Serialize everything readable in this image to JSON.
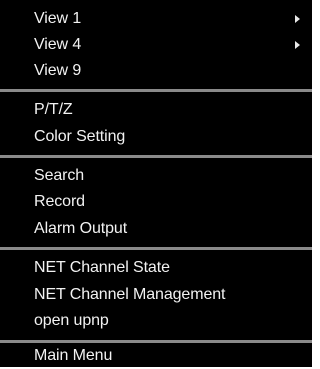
{
  "menu": {
    "groups": [
      {
        "items": [
          {
            "label": "View 1",
            "submenu": true
          },
          {
            "label": "View 4",
            "submenu": true
          },
          {
            "label": "View 9",
            "submenu": false
          }
        ]
      },
      {
        "items": [
          {
            "label": "P/T/Z"
          },
          {
            "label": "Color Setting"
          }
        ]
      },
      {
        "items": [
          {
            "label": "Search"
          },
          {
            "label": "Record"
          },
          {
            "label": "Alarm Output"
          }
        ]
      },
      {
        "items": [
          {
            "label": "NET Channel State"
          },
          {
            "label": "NET Channel Management"
          },
          {
            "label": "open upnp"
          }
        ]
      },
      {
        "items": [
          {
            "label": "Main Menu"
          }
        ]
      }
    ],
    "arrow_icon": "chevron-right-icon",
    "colors": {
      "background": "#000000",
      "text": "#f2f2f2",
      "divider": "#8a8a8a"
    }
  }
}
